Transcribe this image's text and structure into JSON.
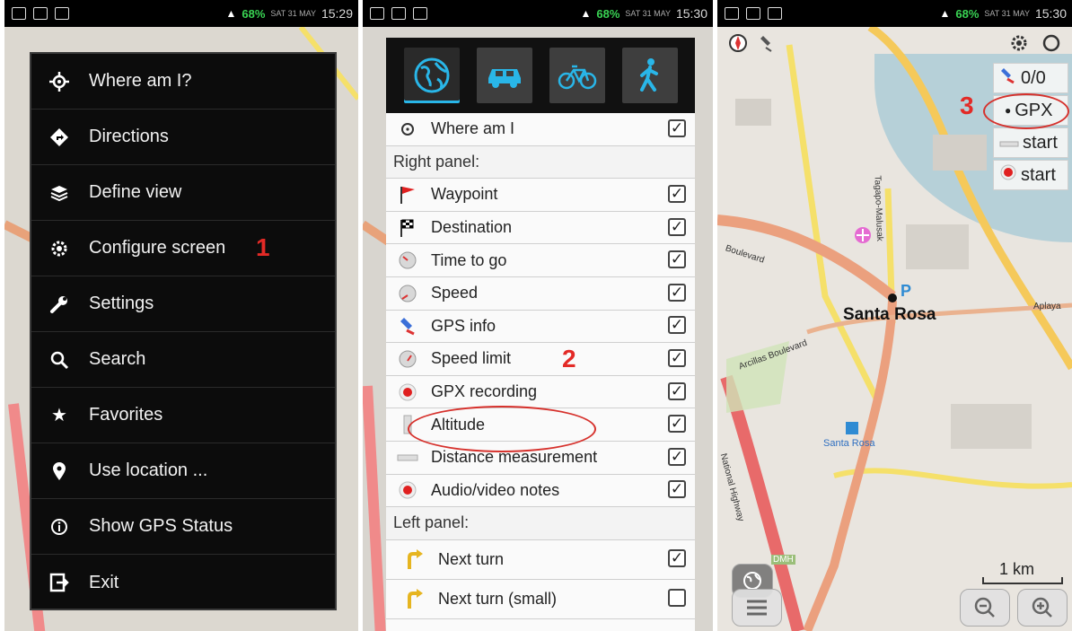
{
  "statusbar": {
    "battery": "68%",
    "date1": "SAT 31 MAY",
    "time1": "15:29",
    "date2": "SAT 31 MAY",
    "time2": "15:30",
    "date3": "SAT 31 MAY",
    "time3": "15:30"
  },
  "menu": {
    "items": [
      {
        "label": "Where am I?",
        "icon": "crosshair-icon"
      },
      {
        "label": "Directions",
        "icon": "directions-diamond-icon"
      },
      {
        "label": "Define view",
        "icon": "layers-icon"
      },
      {
        "label": "Configure screen",
        "icon": "gear-icon"
      },
      {
        "label": "Settings",
        "icon": "wrench-icon"
      },
      {
        "label": "Search",
        "icon": "search-icon"
      },
      {
        "label": "Favorites",
        "icon": "star-icon"
      },
      {
        "label": "Use location ...",
        "icon": "location-pin-icon"
      },
      {
        "label": "Show GPS Status",
        "icon": "info-icon"
      },
      {
        "label": "Exit",
        "icon": "exit-icon"
      }
    ],
    "callout": "1"
  },
  "configure": {
    "modes": [
      "globe-icon",
      "car-icon",
      "bicycle-icon",
      "pedestrian-icon"
    ],
    "where_am_i": "Where am I",
    "right_panel_header": "Right panel:",
    "left_panel_header": "Left panel:",
    "right_items": [
      {
        "label": "Waypoint",
        "checked": true
      },
      {
        "label": "Destination",
        "checked": true
      },
      {
        "label": "Time to go",
        "checked": true
      },
      {
        "label": "Speed",
        "checked": true
      },
      {
        "label": "GPS info",
        "checked": true
      },
      {
        "label": "Speed limit",
        "checked": true
      },
      {
        "label": "GPX recording",
        "checked": true
      },
      {
        "label": "Altitude",
        "checked": true
      },
      {
        "label": "Distance measurement",
        "checked": true
      },
      {
        "label": "Audio/video notes",
        "checked": true
      }
    ],
    "left_items": [
      {
        "label": "Next turn",
        "checked": true
      },
      {
        "label": "Next turn (small)",
        "checked": false
      }
    ],
    "callout": "2"
  },
  "map": {
    "right_panel": [
      {
        "label": "0/0",
        "icon": "satellite-icon"
      },
      {
        "label": "GPX",
        "icon": "dot-icon"
      },
      {
        "label": "start",
        "icon": "ruler-icon"
      },
      {
        "label": "start",
        "icon": "record-icon"
      }
    ],
    "callout": "3",
    "place": "Santa Rosa",
    "station": "Santa Rosa",
    "scale": "1 km",
    "road1": "Boulevard",
    "road2": "Arcillas Boulevard",
    "road3": "National Highway",
    "road4": "Aplaya",
    "road5": "Tagapo-Malusak",
    "road6": "DMH"
  }
}
